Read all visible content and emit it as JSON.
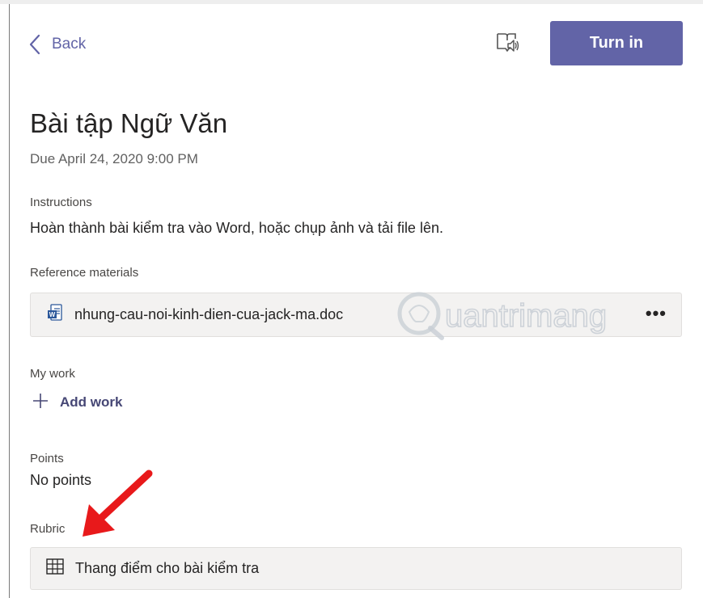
{
  "header": {
    "back_label": "Back",
    "turn_in_label": "Turn in"
  },
  "assignment": {
    "title": "Bài tập Ngữ Văn",
    "due": "Due April 24, 2020 9:00 PM"
  },
  "instructions": {
    "label": "Instructions",
    "text": "Hoàn thành bài kiểm tra vào Word, hoặc chụp ảnh và tải file lên."
  },
  "reference": {
    "label": "Reference materials",
    "file_name": "nhung-cau-noi-kinh-dien-cua-jack-ma.doc",
    "more": "•••",
    "file_icon": "word-doc-icon"
  },
  "my_work": {
    "label": "My work",
    "add_label": "Add work"
  },
  "points": {
    "label": "Points",
    "value": "No points"
  },
  "rubric": {
    "label": "Rubric",
    "name": "Thang điểm cho bài kiểm tra",
    "icon": "table-grid-icon"
  },
  "watermark": {
    "text": "uantrimang"
  },
  "colors": {
    "accent": "#6264a7",
    "card_bg": "#f3f2f1",
    "annotation_arrow": "#e8191b"
  }
}
